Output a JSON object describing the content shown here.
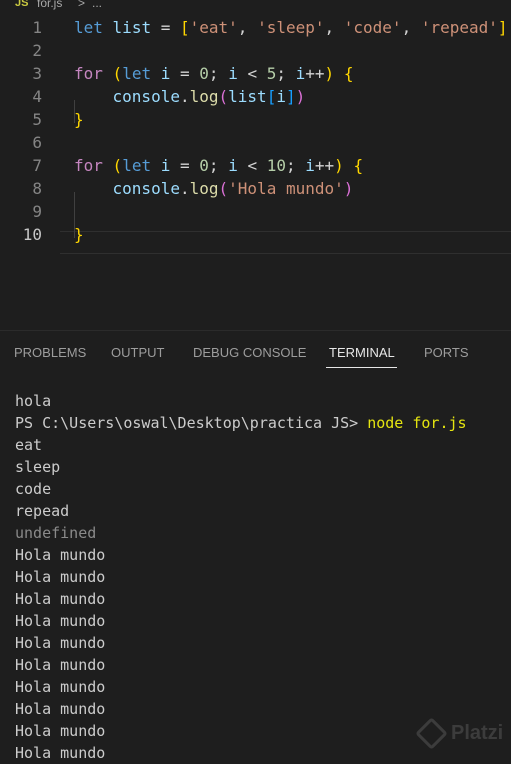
{
  "breadcrumb": {
    "badge": "JS",
    "file": "for.js",
    "separator": ">",
    "more": "..."
  },
  "editor": {
    "line_numbers": [
      "1",
      "2",
      "3",
      "4",
      "5",
      "6",
      "7",
      "8",
      "9",
      "10"
    ],
    "active_line": 10,
    "lines": [
      [
        [
          "kw",
          "let"
        ],
        [
          "op",
          " "
        ],
        [
          "var",
          "list"
        ],
        [
          "op",
          " = "
        ],
        [
          "b1",
          "["
        ],
        [
          "str",
          "'eat'"
        ],
        [
          "op",
          ", "
        ],
        [
          "str",
          "'sleep'"
        ],
        [
          "op",
          ", "
        ],
        [
          "str",
          "'code'"
        ],
        [
          "op",
          ", "
        ],
        [
          "str",
          "'repead'"
        ],
        [
          "b1",
          "]"
        ]
      ],
      [],
      [
        [
          "ctrl",
          "for"
        ],
        [
          "op",
          " "
        ],
        [
          "b1",
          "("
        ],
        [
          "kw",
          "let"
        ],
        [
          "op",
          " "
        ],
        [
          "var",
          "i"
        ],
        [
          "op",
          " = "
        ],
        [
          "num",
          "0"
        ],
        [
          "op",
          "; "
        ],
        [
          "var",
          "i"
        ],
        [
          "op",
          " < "
        ],
        [
          "num",
          "5"
        ],
        [
          "op",
          "; "
        ],
        [
          "var",
          "i"
        ],
        [
          "op",
          "++"
        ],
        [
          "b1",
          ")"
        ],
        [
          "op",
          " "
        ],
        [
          "b1",
          "{"
        ]
      ],
      [
        [
          "op",
          "    "
        ],
        [
          "var",
          "console"
        ],
        [
          "op",
          "."
        ],
        [
          "fn",
          "log"
        ],
        [
          "b2",
          "("
        ],
        [
          "var",
          "list"
        ],
        [
          "b3",
          "["
        ],
        [
          "var",
          "i"
        ],
        [
          "b3",
          "]"
        ],
        [
          "b2",
          ")"
        ]
      ],
      [
        [
          "b1",
          "}"
        ]
      ],
      [],
      [
        [
          "ctrl",
          "for"
        ],
        [
          "op",
          " "
        ],
        [
          "b1",
          "("
        ],
        [
          "kw",
          "let"
        ],
        [
          "op",
          " "
        ],
        [
          "var",
          "i"
        ],
        [
          "op",
          " = "
        ],
        [
          "num",
          "0"
        ],
        [
          "op",
          "; "
        ],
        [
          "var",
          "i"
        ],
        [
          "op",
          " < "
        ],
        [
          "num",
          "10"
        ],
        [
          "op",
          "; "
        ],
        [
          "var",
          "i"
        ],
        [
          "op",
          "++"
        ],
        [
          "b1",
          ")"
        ],
        [
          "op",
          " "
        ],
        [
          "b1",
          "{"
        ]
      ],
      [
        [
          "op",
          "    "
        ],
        [
          "var",
          "console"
        ],
        [
          "op",
          "."
        ],
        [
          "fn",
          "log"
        ],
        [
          "b2",
          "("
        ],
        [
          "str",
          "'Hola mundo'"
        ],
        [
          "b2",
          ")"
        ]
      ],
      [],
      [
        [
          "b1",
          "}"
        ]
      ]
    ]
  },
  "panel": {
    "tabs": [
      {
        "label": "PROBLEMS",
        "active": false
      },
      {
        "label": "OUTPUT",
        "active": false
      },
      {
        "label": "DEBUG CONSOLE",
        "active": false
      },
      {
        "label": "TERMINAL",
        "active": true
      },
      {
        "label": "PORTS",
        "active": false
      }
    ]
  },
  "terminal": {
    "first": "hola",
    "prompt": "PS C:\\Users\\oswal\\Desktop\\practica JS> ",
    "command": "node for.js",
    "output": [
      {
        "text": "eat",
        "dim": false
      },
      {
        "text": "sleep",
        "dim": false
      },
      {
        "text": "code",
        "dim": false
      },
      {
        "text": "repead",
        "dim": false
      },
      {
        "text": "undefined",
        "dim": true
      },
      {
        "text": "Hola mundo",
        "dim": false
      },
      {
        "text": "Hola mundo",
        "dim": false
      },
      {
        "text": "Hola mundo",
        "dim": false
      },
      {
        "text": "Hola mundo",
        "dim": false
      },
      {
        "text": "Hola mundo",
        "dim": false
      },
      {
        "text": "Hola mundo",
        "dim": false
      },
      {
        "text": "Hola mundo",
        "dim": false
      },
      {
        "text": "Hola mundo",
        "dim": false
      },
      {
        "text": "Hola mundo",
        "dim": false
      },
      {
        "text": "Hola mundo",
        "dim": false
      }
    ]
  },
  "watermark": {
    "text": "Platzi"
  }
}
